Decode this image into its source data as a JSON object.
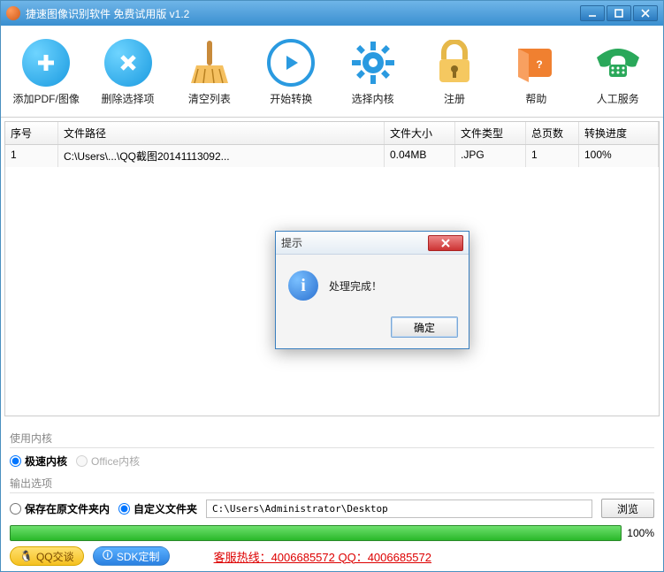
{
  "titlebar": {
    "title": "捷速图像识别软件 免费试用版 v1.2"
  },
  "toolbar": {
    "add": "添加PDF/图像",
    "del": "删除选择项",
    "clear": "清空列表",
    "start": "开始转换",
    "engine": "选择内核",
    "register": "注册",
    "help": "帮助",
    "service": "人工服务"
  },
  "table": {
    "headers": {
      "index": "序号",
      "path": "文件路径",
      "size": "文件大小",
      "type": "文件类型",
      "pages": "总页数",
      "progress": "转换进度"
    },
    "rows": [
      {
        "index": "1",
        "path": "C:\\Users\\...\\QQ截图20141113092...",
        "size": "0.04MB",
        "type": ".JPG",
        "pages": "1",
        "progress": "100%"
      }
    ]
  },
  "engine": {
    "group_label": "使用内核",
    "fast": "极速内核",
    "office": "Office内核"
  },
  "output": {
    "group_label": "输出选项",
    "same_folder": "保存在原文件夹内",
    "custom_folder": "自定义文件夹",
    "path": "C:\\Users\\Administrator\\Desktop",
    "browse": "浏览"
  },
  "progress": {
    "pct": "100%"
  },
  "footer": {
    "qq": "QQ交谈",
    "sdk": "SDK定制",
    "hotline": "客服热线：4006685572 QQ：4006685572"
  },
  "dialog": {
    "title": "提示",
    "message": "处理完成！",
    "ok": "确定"
  }
}
